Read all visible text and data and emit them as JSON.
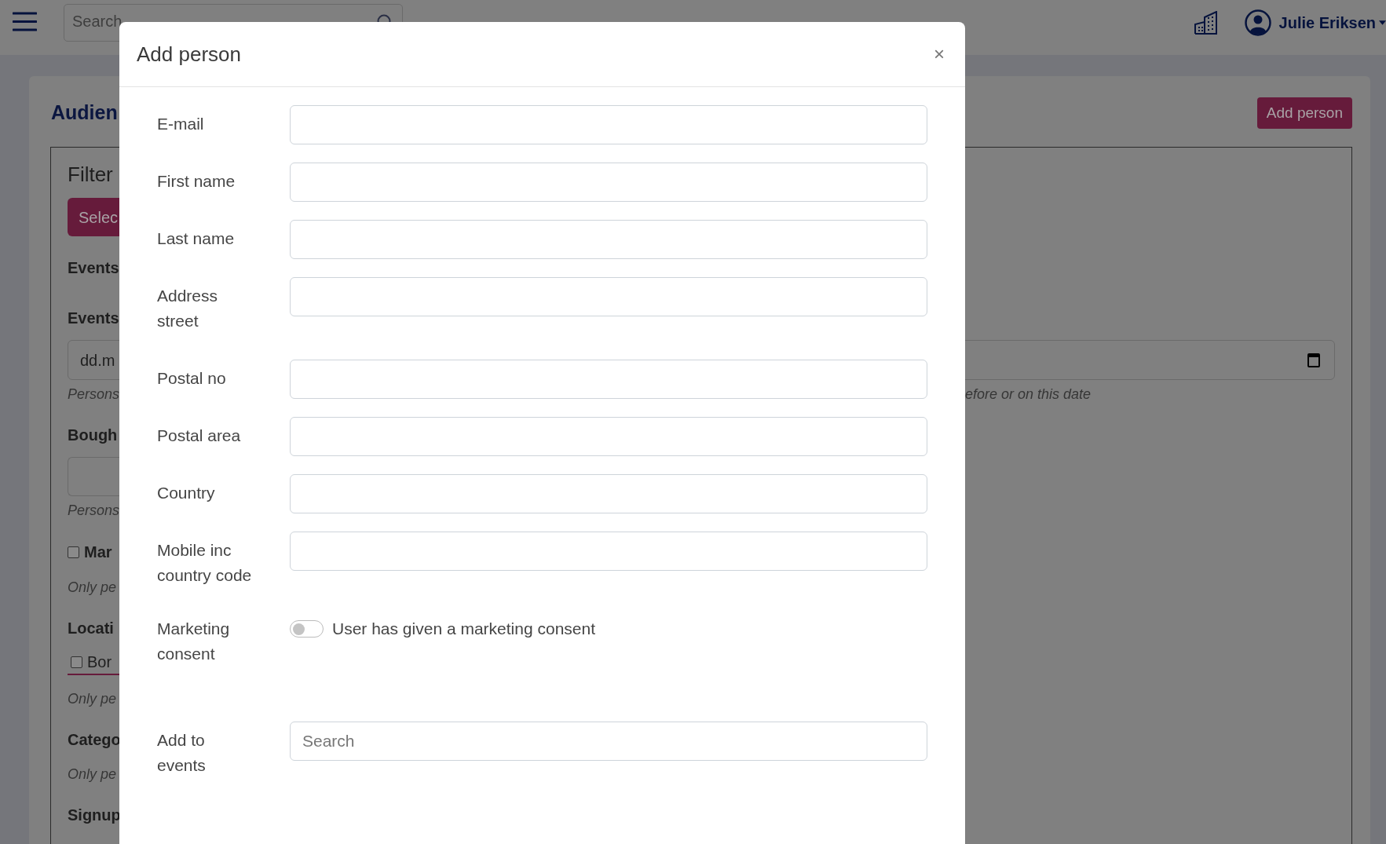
{
  "header": {
    "search_placeholder": "Search",
    "user": "Julie Eriksen"
  },
  "page": {
    "title": "Audien",
    "add_button": "Add person",
    "filter": [
      {
        "kind": "heading",
        "text": "Filter"
      },
      {
        "kind": "button",
        "text": "Selec"
      },
      {
        "kind": "label",
        "text": "Events"
      },
      {
        "kind": "label",
        "text": "Events"
      },
      {
        "kind": "date",
        "text": "dd.m"
      },
      {
        "kind": "help",
        "text": "Persons",
        "tail": "efore or on this date"
      },
      {
        "kind": "label",
        "text": "Bough"
      },
      {
        "kind": "input"
      },
      {
        "kind": "help",
        "text": "Persons"
      },
      {
        "kind": "check",
        "text": "Mar",
        "checked": false
      },
      {
        "kind": "help",
        "text": "Only pe"
      },
      {
        "kind": "label",
        "text": "Locati"
      },
      {
        "kind": "tabcheck",
        "text": "Bor",
        "checked": false
      },
      {
        "kind": "help",
        "text": "Only pe"
      },
      {
        "kind": "label",
        "text": "Catego"
      },
      {
        "kind": "help",
        "text": "Only pe"
      },
      {
        "kind": "label",
        "text": "Signup"
      }
    ]
  },
  "modal": {
    "title": "Add person",
    "close": "×",
    "fields": [
      {
        "kind": "text",
        "label": "E-mail"
      },
      {
        "kind": "text",
        "label": "First name"
      },
      {
        "kind": "text",
        "label": "Last name"
      },
      {
        "kind": "text",
        "label": "Address street"
      },
      {
        "kind": "text",
        "label": "Postal no"
      },
      {
        "kind": "text",
        "label": "Postal area"
      },
      {
        "kind": "text",
        "label": "Country"
      },
      {
        "kind": "text",
        "label": "Mobile inc country code"
      },
      {
        "kind": "toggle",
        "label": "Marketing consent",
        "text": "User has given a marketing consent",
        "on": false
      },
      {
        "kind": "search",
        "label": "Add to events",
        "placeholder": "Search"
      }
    ]
  }
}
